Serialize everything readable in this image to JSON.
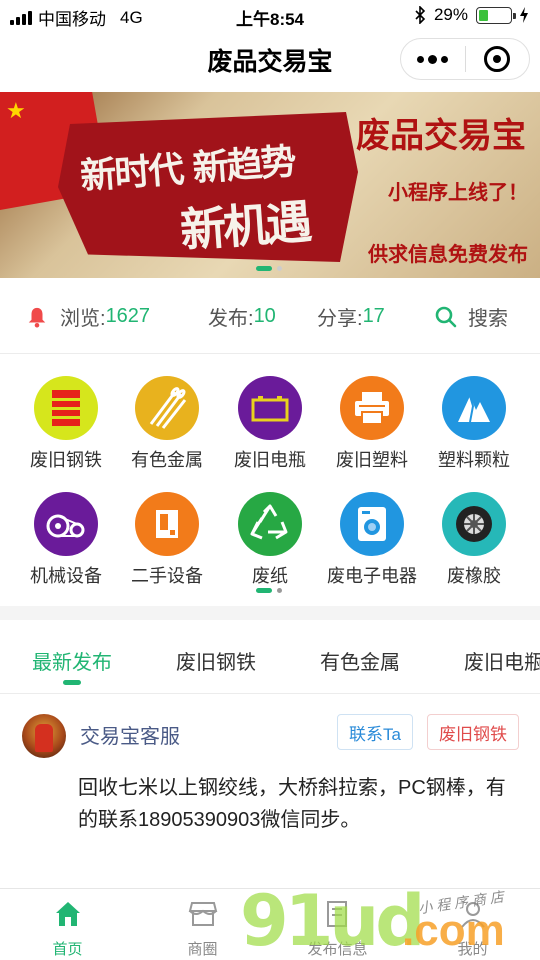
{
  "status_bar": {
    "carrier": "中国移动",
    "network": "4G",
    "time": "上午8:54",
    "battery_percent": "29%",
    "battery_level": 0.29
  },
  "navbar": {
    "title": "废品交易宝"
  },
  "banner": {
    "slogan_line1": "新时代 新趋势",
    "slogan_line2": "新机遇",
    "title": "废品交易宝",
    "subtitle": "小程序上线了！",
    "tagline": "供求信息免费发布",
    "slide_count": 2,
    "active_slide": 1
  },
  "stats": {
    "views_label": "浏览:",
    "views_value": "1627",
    "posts_label": "发布:",
    "posts_value": "10",
    "shares_label": "分享:",
    "shares_value": "17",
    "search_label": "搜索"
  },
  "categories": [
    {
      "label": "废旧钢铁",
      "icon": "steel-icon",
      "color": "#d6e61c"
    },
    {
      "label": "有色金属",
      "icon": "metal-rods-icon",
      "color": "#e8b21e"
    },
    {
      "label": "废旧电瓶",
      "icon": "battery-icon",
      "color": "#6a1b9a"
    },
    {
      "label": "废旧塑料",
      "icon": "printer-icon",
      "color": "#f27b1a"
    },
    {
      "label": "塑料颗粒",
      "icon": "mountain-icon",
      "color": "#2196e0"
    },
    {
      "label": "机械设备",
      "icon": "gear-machine-icon",
      "color": "#6a1b9a"
    },
    {
      "label": "二手设备",
      "icon": "device-icon",
      "color": "#f27b1a"
    },
    {
      "label": "废纸",
      "icon": "recycle-icon",
      "color": "#27a844"
    },
    {
      "label": "废电子电器",
      "icon": "washing-machine-icon",
      "color": "#2196e0"
    },
    {
      "label": "废橡胶",
      "icon": "tire-icon",
      "color": "#26b8b8"
    }
  ],
  "tabs": [
    {
      "label": "最新发布",
      "active": true
    },
    {
      "label": "废旧钢铁",
      "active": false
    },
    {
      "label": "有色金属",
      "active": false
    },
    {
      "label": "废旧电瓶",
      "active": false
    }
  ],
  "post": {
    "author": "交易宝客服",
    "contact_button": "联系Ta",
    "tag": "废旧钢铁",
    "content": "回收七米以上钢绞线，大桥斜拉索，PC钢棒，有的联系18905390903微信同步。"
  },
  "tabbar": [
    {
      "label": "首页",
      "icon": "home-icon",
      "active": true
    },
    {
      "label": "商圈",
      "icon": "store-icon",
      "active": false
    },
    {
      "label": "发布信息",
      "icon": "edit-icon",
      "active": false
    },
    {
      "label": "我的",
      "icon": "user-icon",
      "active": false
    }
  ],
  "watermark": {
    "number": "91ud",
    "domain": ".com",
    "shop_text": "小程序商店"
  },
  "colors": {
    "accent": "#21b573",
    "link_blue": "#2b8bd8",
    "tag_red": "#e04b4b"
  }
}
